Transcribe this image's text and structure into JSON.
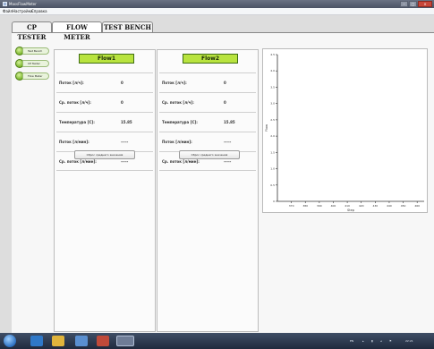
{
  "window": {
    "title": "MassFlowMeter"
  },
  "menu": [
    "Файл",
    "Настройки",
    "Справка"
  ],
  "tabs": [
    "CP TESTER",
    "FLOW METER",
    "TEST BENCH"
  ],
  "active_tab": 1,
  "sidebar": [
    {
      "label": "Test Bench"
    },
    {
      "label": "CP Tester"
    },
    {
      "label": "Flow Meter"
    }
  ],
  "panels": [
    {
      "title": "Flow1",
      "rows": [
        {
          "label": "Поток [л/ч]:",
          "value": "0"
        },
        {
          "label": "Ср. поток [л/ч]:",
          "value": "0"
        },
        {
          "label": "Температура [C]:",
          "value": "15.85"
        },
        {
          "label": "Поток [л/мин]:",
          "value": "-----"
        },
        {
          "label": "Ср. поток [л/мин]:",
          "value": "-----"
        }
      ],
      "reset_button": "Сброс среднего значения"
    },
    {
      "title": "Flow2",
      "rows": [
        {
          "label": "Поток [л/ч]:",
          "value": "0"
        },
        {
          "label": "Ср. поток [л/ч]:",
          "value": "0"
        },
        {
          "label": "Температура [C]:",
          "value": "15.85"
        },
        {
          "label": "Поток [л/мин]:",
          "value": "-----"
        },
        {
          "label": "Ср. поток [л/мин]:",
          "value": "-----"
        }
      ],
      "reset_button": "Сброс среднего значения"
    }
  ],
  "chart_data": {
    "type": "line",
    "xlabel": "Step",
    "ylabel": "Flow",
    "xlim": [
      360,
      465
    ],
    "ylim": [
      0,
      4.5
    ],
    "x_ticks": [
      "370",
      "380",
      "390",
      "400",
      "410",
      "420",
      "430",
      "440",
      "450",
      "460"
    ],
    "y_ticks": [
      "0",
      "0.5",
      "1.0",
      "1.5",
      "2.0",
      "2.5",
      "3.0",
      "3.5",
      "4.0",
      "4.5"
    ],
    "series": []
  },
  "taskbar": {
    "tray_lang": "EN",
    "clock": "22:21"
  }
}
